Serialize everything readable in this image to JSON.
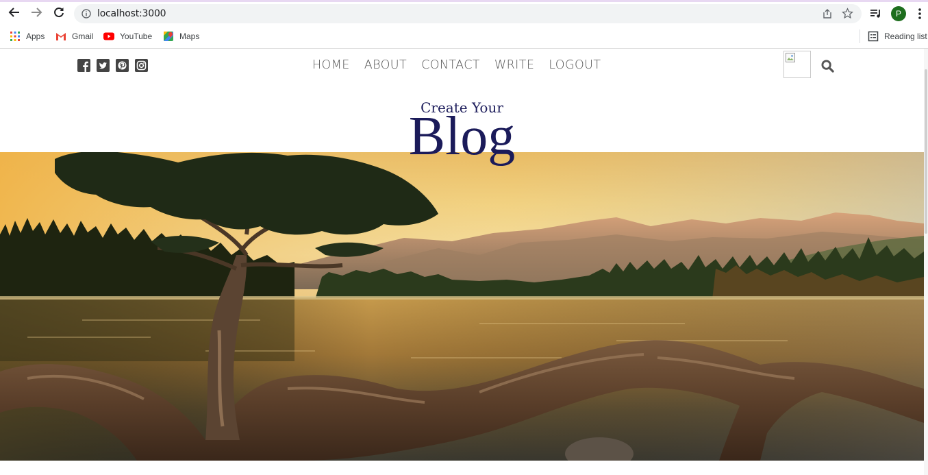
{
  "browser": {
    "url": "localhost:3000",
    "profile_initial": "P",
    "bookmarks": [
      {
        "label": "Apps",
        "icon": "apps-grid-icon"
      },
      {
        "label": "Gmail",
        "icon": "gmail-icon"
      },
      {
        "label": "YouTube",
        "icon": "youtube-icon"
      },
      {
        "label": "Maps",
        "icon": "maps-icon"
      }
    ],
    "reading_list": "Reading list"
  },
  "site": {
    "social": [
      "facebook-icon",
      "twitter-icon",
      "pinterest-icon",
      "instagram-icon"
    ],
    "nav": [
      "HOME",
      "ABOUT",
      "CONTACT",
      "WRITE",
      "LOGOUT"
    ],
    "header_small": "Create Your",
    "header_large": "Blog",
    "colors": {
      "title": "#1b1b5a",
      "menu": "#555555"
    }
  }
}
